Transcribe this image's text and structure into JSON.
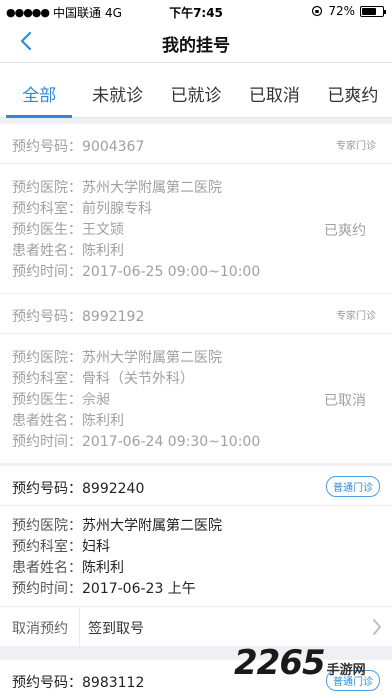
{
  "status_bar": {
    "signal": "●●●●●",
    "carrier": "中国联通",
    "network": "4G",
    "time": "下午7:45",
    "battery": "72%",
    "battery_level": 0.72
  },
  "nav": {
    "title": "我的挂号"
  },
  "tabs": [
    {
      "label": "全部",
      "active": true
    },
    {
      "label": "未就诊",
      "active": false
    },
    {
      "label": "已就诊",
      "active": false
    },
    {
      "label": "已取消",
      "active": false
    },
    {
      "label": "已爽约",
      "active": false
    }
  ],
  "cards": [
    {
      "number": "预约号码：9004367",
      "badge": "专家门诊",
      "rows": [
        {
          "label": "预约医院：",
          "value": "苏州大学附属第二医院"
        },
        {
          "label": "预约科室：",
          "value": "前列腺专科"
        },
        {
          "label": "预约医生：",
          "value": "王文颎"
        },
        {
          "label": "患者姓名：",
          "value": "陈利利"
        },
        {
          "label": "预约时间：",
          "value": "2017-06-25 09:00~10:00"
        }
      ],
      "status": "已爽约"
    },
    {
      "number": "预约号码：8992192",
      "badge": "专家门诊",
      "rows": [
        {
          "label": "预约医院：",
          "value": "苏州大学附属第二医院"
        },
        {
          "label": "预约科室：",
          "value": "骨科（关节外科）"
        },
        {
          "label": "预约医生：",
          "value": "佘昶"
        },
        {
          "label": "患者姓名：",
          "value": "陈利利"
        },
        {
          "label": "预约时间：",
          "value": "2017-06-24 09:30~10:00"
        }
      ],
      "status": "已取消"
    },
    {
      "number": "预约号码：8992240",
      "badge": "普通门诊",
      "rows": [
        {
          "label": "预约医院：",
          "value": "苏州大学附属第二医院"
        },
        {
          "label": "预约科室：",
          "value": "妇科"
        },
        {
          "label": "患者姓名：",
          "value": "陈利利"
        },
        {
          "label": "预约时间：",
          "value": "2017-06-23 上午"
        }
      ],
      "actions": {
        "cancel": "取消预约",
        "checkin": "签到取号"
      }
    },
    {
      "number": "预约号码：8983112",
      "badge": "普通门诊"
    }
  ],
  "watermark": {
    "big": "2265",
    "sub": "手游网"
  },
  "colors": {
    "accent": "#2d8bd9",
    "muted": "#a0a0a0",
    "background": "#efeff4"
  }
}
